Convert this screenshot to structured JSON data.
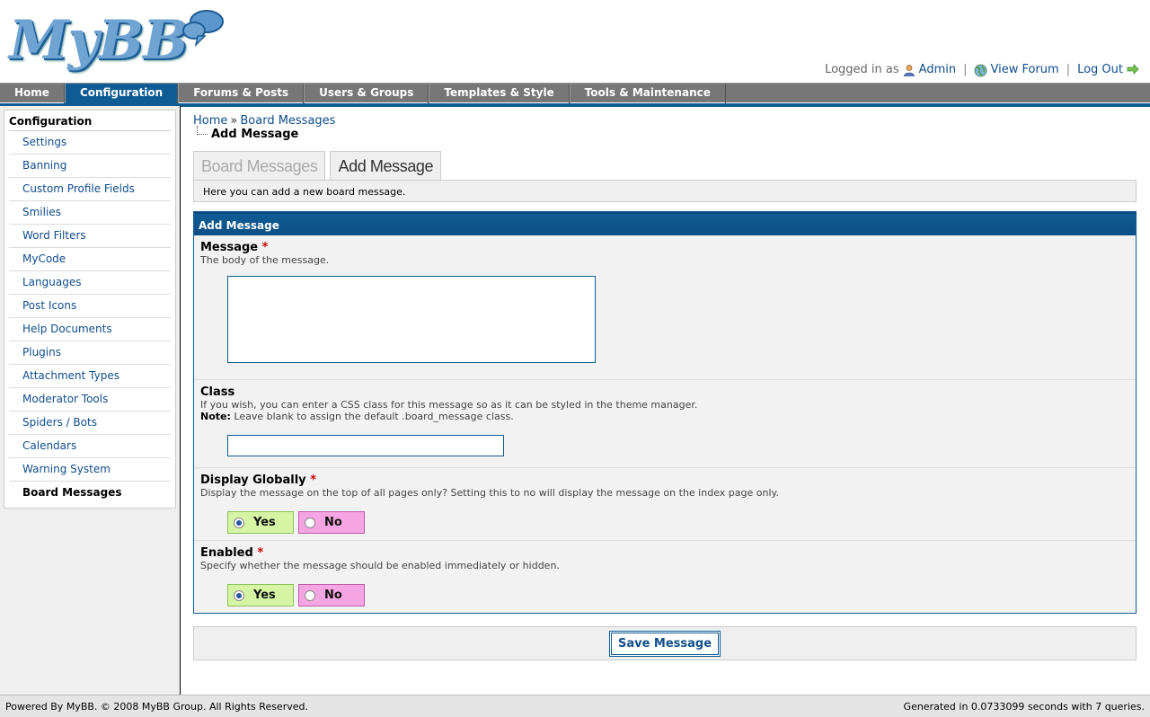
{
  "brand": {
    "logo_text": "MyBB"
  },
  "welcome": {
    "logged_in_as": "Logged in as",
    "user": "Admin",
    "view_forum": "View Forum",
    "log_out": "Log Out"
  },
  "nav": {
    "items": [
      {
        "label": "Home"
      },
      {
        "label": "Configuration"
      },
      {
        "label": "Forums & Posts"
      },
      {
        "label": "Users & Groups"
      },
      {
        "label": "Templates & Style"
      },
      {
        "label": "Tools & Maintenance"
      }
    ],
    "active": "Configuration"
  },
  "sidebar": {
    "title": "Configuration",
    "items": [
      {
        "label": "Settings"
      },
      {
        "label": "Banning"
      },
      {
        "label": "Custom Profile Fields"
      },
      {
        "label": "Smilies"
      },
      {
        "label": "Word Filters"
      },
      {
        "label": "MyCode"
      },
      {
        "label": "Languages"
      },
      {
        "label": "Post Icons"
      },
      {
        "label": "Help Documents"
      },
      {
        "label": "Plugins"
      },
      {
        "label": "Attachment Types"
      },
      {
        "label": "Moderator Tools"
      },
      {
        "label": "Spiders / Bots"
      },
      {
        "label": "Calendars"
      },
      {
        "label": "Warning System"
      },
      {
        "label": "Board Messages"
      }
    ],
    "active": "Board Messages"
  },
  "breadcrumb": {
    "home": "Home",
    "sep": "»",
    "section": "Board Messages",
    "current": "Add Message"
  },
  "tabs": [
    {
      "label": "Board Messages"
    },
    {
      "label": "Add Message"
    }
  ],
  "tab_description": "Here you can add a new board message.",
  "form": {
    "title": "Add Message",
    "message": {
      "label": "Message",
      "required": "*",
      "description": "The body of the message.",
      "value": ""
    },
    "class": {
      "label": "Class",
      "description": "If you wish, you can enter a CSS class for this message so as it can be styled in the theme manager.",
      "note_label": "Note:",
      "note": " Leave blank to assign the default .board_message class.",
      "value": ""
    },
    "display_globally": {
      "label": "Display Globally",
      "required": "*",
      "description": "Display the message on the top of all pages only? Setting this to no will display the message on the index page only.",
      "yes": "Yes",
      "no": "No",
      "selected": "Yes"
    },
    "enabled": {
      "label": "Enabled",
      "required": "*",
      "description": "Specify whether the message should be enabled immediately or hidden.",
      "yes": "Yes",
      "no": "No",
      "selected": "Yes"
    },
    "submit": "Save Message"
  },
  "footer": {
    "left": "Powered By MyBB. © 2008 MyBB Group. All Rights Reserved.",
    "right": "Generated in 0.0733099 seconds with 7 queries."
  },
  "colors": {
    "accent": "#0f5c95",
    "yes_bg": "#d5f5a5",
    "no_bg": "#f5a5e2"
  }
}
